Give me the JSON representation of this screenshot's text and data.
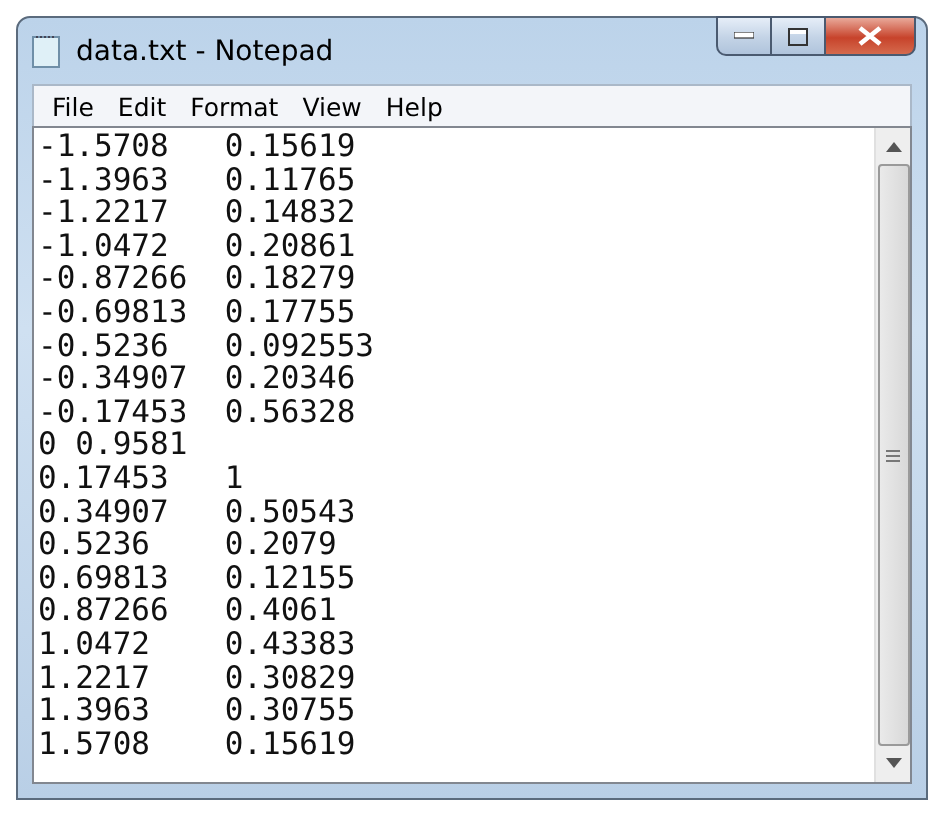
{
  "window": {
    "title": "data.txt - Notepad"
  },
  "menu": [
    "File",
    "Edit",
    "Format",
    "View",
    "Help"
  ],
  "lines": [
    "-1.5708\t0.15619",
    "-1.3963\t0.11765",
    "-1.2217\t0.14832",
    "-1.0472\t0.20861",
    "-0.87266\t0.18279",
    "-0.69813\t0.17755",
    "-0.5236\t0.092553",
    "-0.34907\t0.20346",
    "-0.17453\t0.56328",
    "0 0.9581",
    "0.17453\t1",
    "0.34907\t0.50543",
    "0.5236\t0.2079",
    "0.69813\t0.12155",
    "0.87266\t0.4061",
    "1.0472\t0.43383",
    "1.2217\t0.30829",
    "1.3963\t0.30755",
    "1.5708\t0.15619"
  ]
}
